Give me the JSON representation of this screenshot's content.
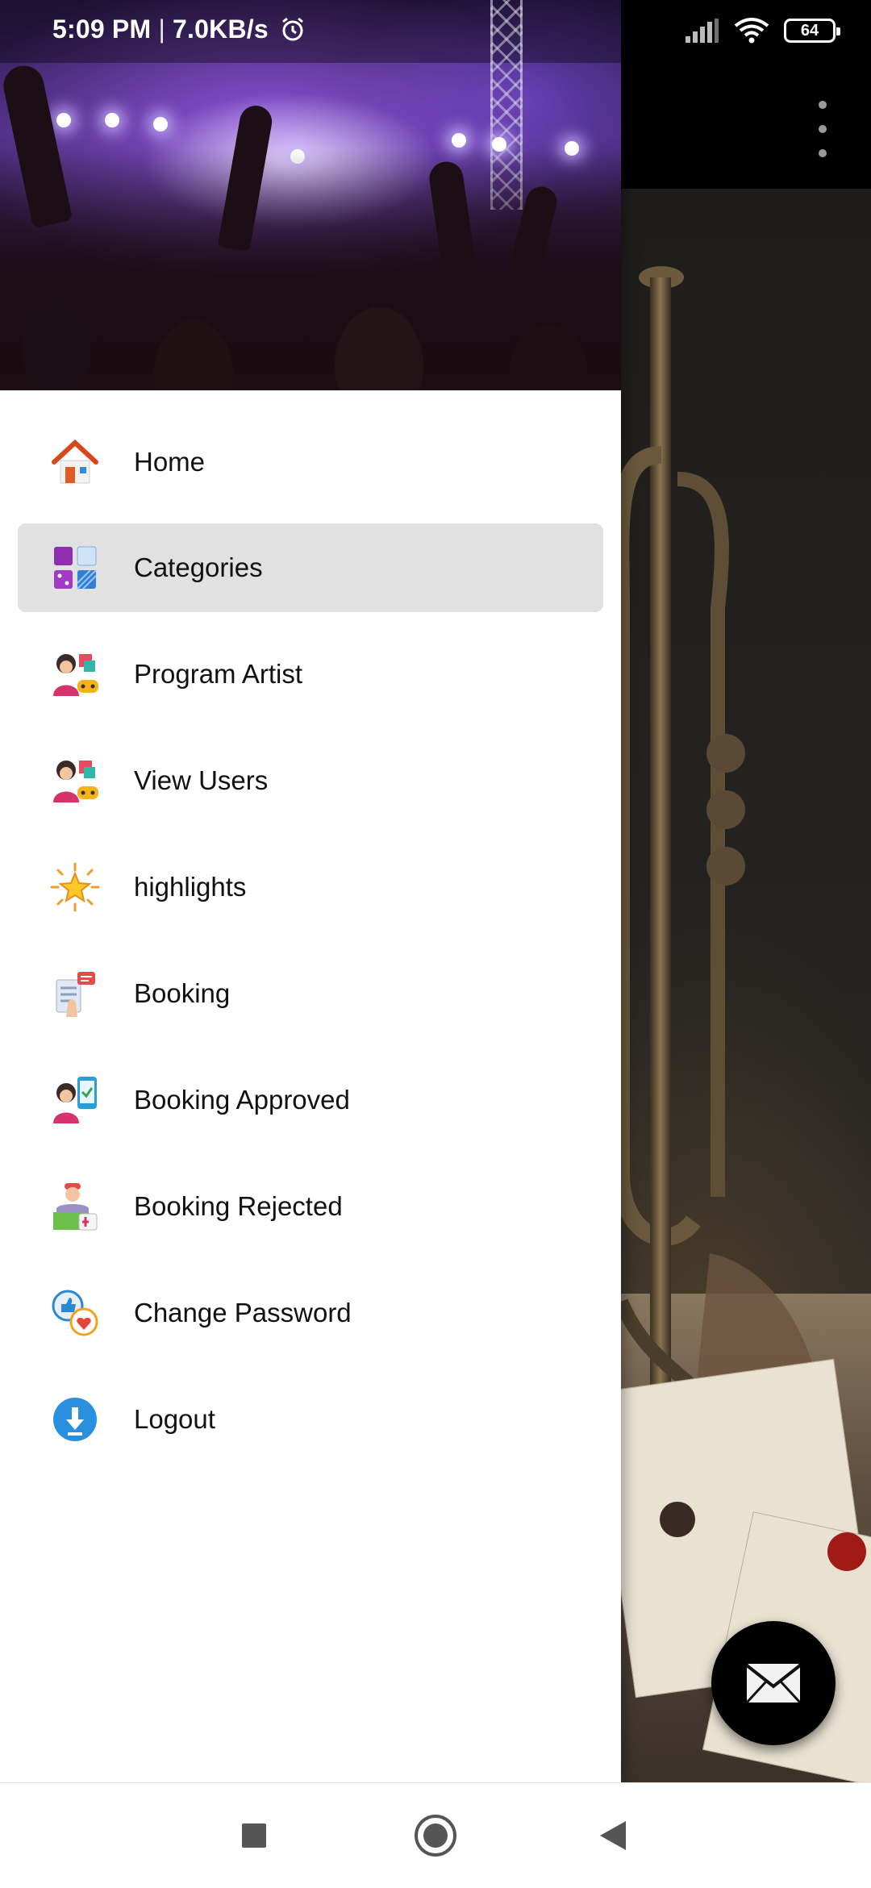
{
  "status_bar": {
    "time": "5:09 PM",
    "separator": "|",
    "net_speed": "7.0KB/s",
    "battery_level": "64",
    "icons": [
      "alarm-icon",
      "signal-icon",
      "wifi-icon",
      "battery-icon"
    ]
  },
  "app_bar": {
    "overflow_icon": "more-vert-icon"
  },
  "drawer": {
    "header_image": "concert-crowd-photo",
    "items": [
      {
        "label": "Home",
        "icon": "home-icon",
        "active": false
      },
      {
        "label": "Categories",
        "icon": "categories-icon",
        "active": true
      },
      {
        "label": "Program Artist",
        "icon": "artist-icon",
        "active": false
      },
      {
        "label": "View Users",
        "icon": "users-icon",
        "active": false
      },
      {
        "label": "highlights",
        "icon": "star-icon",
        "active": false
      },
      {
        "label": "Booking",
        "icon": "booking-icon",
        "active": false
      },
      {
        "label": "Booking Approved",
        "icon": "booking-approved-icon",
        "active": false
      },
      {
        "label": "Booking Rejected",
        "icon": "booking-rejected-icon",
        "active": false
      },
      {
        "label": "Change Password",
        "icon": "change-password-icon",
        "active": false
      },
      {
        "label": "Logout",
        "icon": "logout-icon",
        "active": false
      }
    ],
    "active_bg": "#e1e1e1"
  },
  "background": {
    "image": "trumpet-still-life-photo",
    "fab_icon": "mail-icon"
  },
  "nav_bar": {
    "buttons": [
      "recents-square-icon",
      "home-circle-icon",
      "back-triangle-icon"
    ]
  }
}
